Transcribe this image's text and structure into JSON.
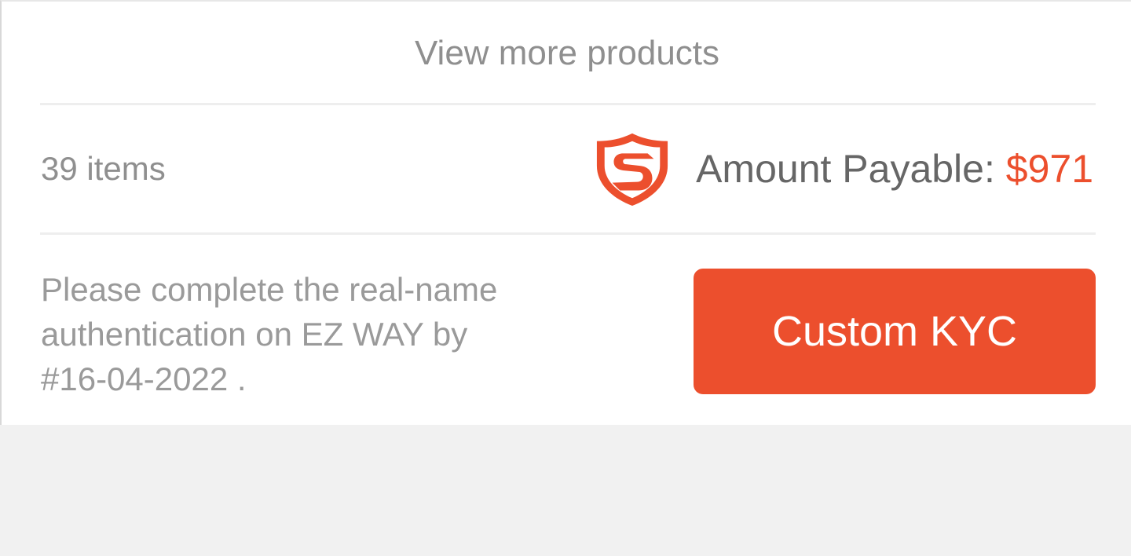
{
  "colors": {
    "accent": "#ec4f2d",
    "text_muted": "#8f8f8f",
    "text_dark": "#666666",
    "background": "#f1f1f1"
  },
  "view_more": {
    "label": "View more products"
  },
  "summary": {
    "item_count": "39 items",
    "shield_icon": "shield-s-icon",
    "amount_label": "Amount Payable: ",
    "amount_value": "$971"
  },
  "notice": {
    "lines": [
      "Please complete the real-name",
      "authentication on EZ WAY by",
      "#16-04-2022 ."
    ]
  },
  "kyc_button": {
    "label": "Custom KYC"
  }
}
